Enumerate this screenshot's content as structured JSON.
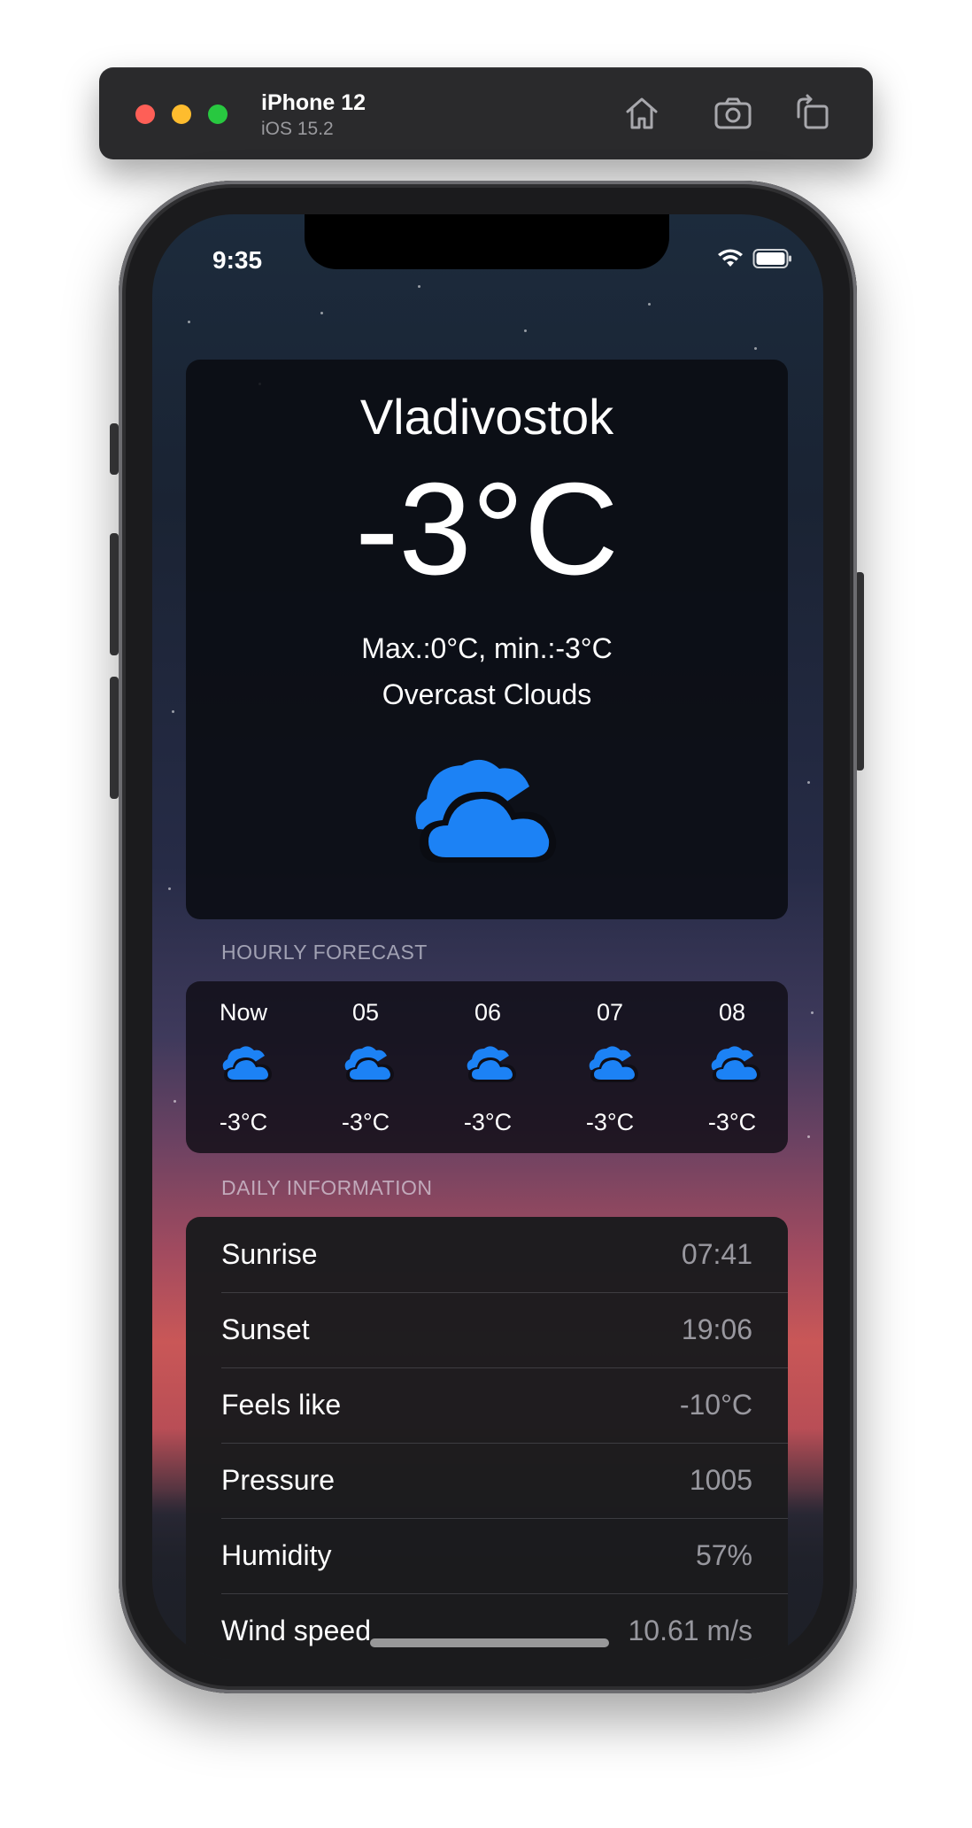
{
  "simulator": {
    "device_name": "iPhone 12",
    "os_version": "iOS 15.2",
    "buttons": [
      "home-icon",
      "screenshot-icon",
      "rotate-icon"
    ]
  },
  "status_bar": {
    "time": "9:35",
    "icons": [
      "wifi-icon",
      "battery-icon"
    ]
  },
  "weather": {
    "city": "Vladivostok",
    "temperature": "-3°C",
    "minmax": "Max.:0°C, min.:-3°C",
    "condition": "Overcast Clouds",
    "icon": "clouds-icon"
  },
  "hourly": {
    "label": "HOURLY FORECAST",
    "items": [
      {
        "time": "Now",
        "temp": "-3°C",
        "icon": "clouds-icon"
      },
      {
        "time": "05",
        "temp": "-3°C",
        "icon": "clouds-icon"
      },
      {
        "time": "06",
        "temp": "-3°C",
        "icon": "clouds-icon"
      },
      {
        "time": "07",
        "temp": "-3°C",
        "icon": "clouds-icon"
      },
      {
        "time": "08",
        "temp": "-3°C",
        "icon": "clouds-icon"
      }
    ]
  },
  "daily": {
    "label": "DAILY INFORMATION",
    "rows": [
      {
        "label": "Sunrise",
        "value": "07:41"
      },
      {
        "label": "Sunset",
        "value": "19:06"
      },
      {
        "label": "Feels like",
        "value": "-10°C"
      },
      {
        "label": "Pressure",
        "value": "1005"
      },
      {
        "label": "Humidity",
        "value": "57%"
      },
      {
        "label": "Wind speed",
        "value": "10.61 m/s"
      }
    ]
  },
  "colors": {
    "accent": "#1c82f5",
    "card": "#0a0c12",
    "secondary_text": "#8e8e93"
  }
}
